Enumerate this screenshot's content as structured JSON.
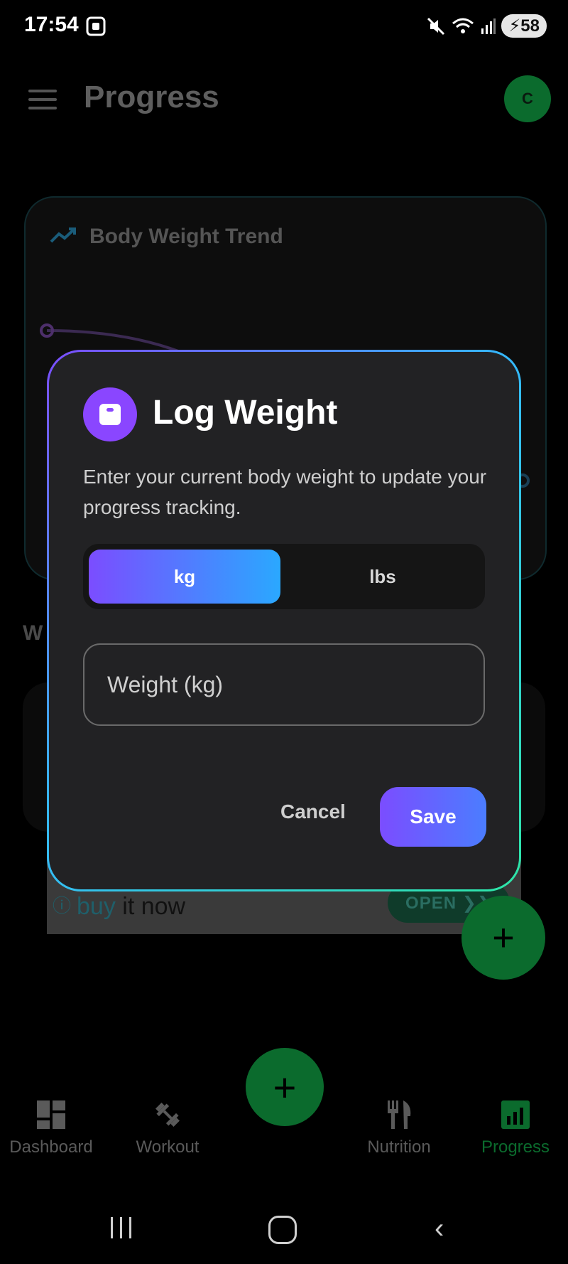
{
  "status_bar": {
    "time": "17:54",
    "battery": "58"
  },
  "app_bar": {
    "title": "Progress",
    "avatar_initial": "C"
  },
  "background": {
    "trend_card_title": "Body Weight Trend",
    "section_heading_partial": "W",
    "ad": {
      "text_highlight": "buy",
      "text_rest": " it now",
      "open_label": "OPEN ❯❯"
    }
  },
  "dialog": {
    "title": "Log Weight",
    "icon": "scale-icon",
    "description": "Enter your current body weight to update your progress tracking.",
    "units": {
      "kg": "kg",
      "lbs": "lbs",
      "selected": "kg"
    },
    "weight_field": {
      "placeholder": "Weight (kg)",
      "value": ""
    },
    "cancel_label": "Cancel",
    "save_label": "Save"
  },
  "bottom_nav": {
    "items": [
      {
        "label": "Dashboard",
        "icon": "dashboard-icon"
      },
      {
        "label": "Workout",
        "icon": "dumbbell-icon"
      },
      {
        "label": "Nutrition",
        "icon": "fork-knife-icon"
      },
      {
        "label": "Progress",
        "icon": "bar-chart-icon"
      }
    ],
    "active": "Progress"
  },
  "colors": {
    "accent_green": "#0b6b2d",
    "accent_purple": "#7b4dff",
    "accent_blue": "#2aa8ff",
    "dialog_bg": "#222224"
  }
}
